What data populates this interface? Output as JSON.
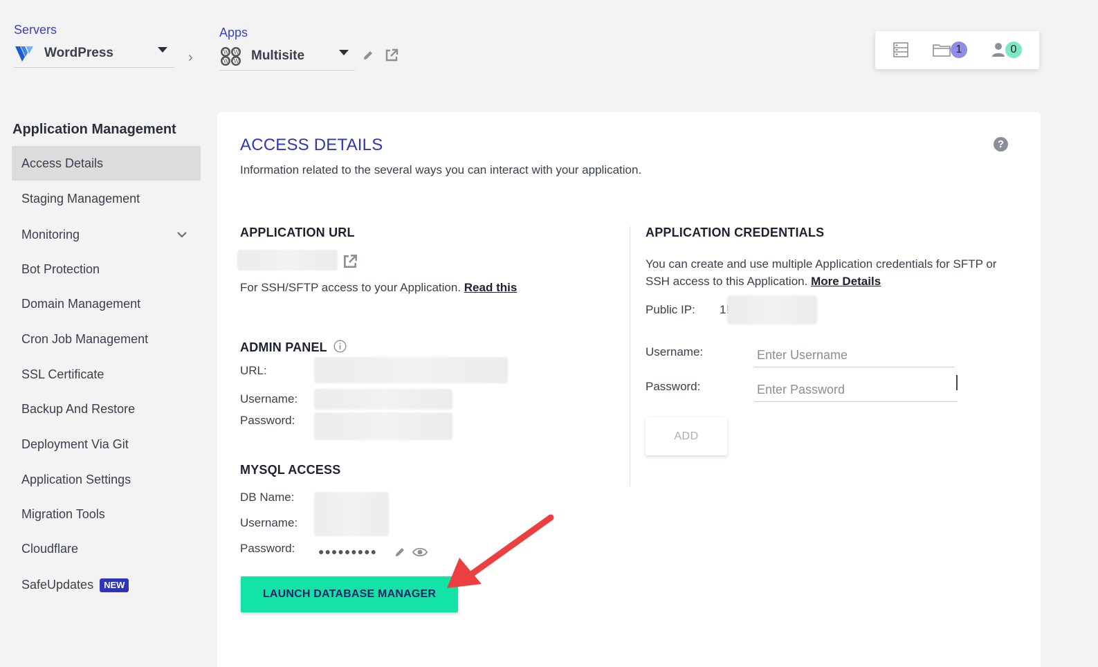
{
  "breadcrumb": {
    "servers_label": "Servers",
    "server_name": "WordPress",
    "apps_label": "Apps",
    "app_name": "Multisite"
  },
  "top_icons": {
    "folder_count": "1",
    "users_count": "0"
  },
  "sidebar": {
    "title": "Application Management",
    "items": [
      {
        "label": "Access Details"
      },
      {
        "label": "Staging Management"
      },
      {
        "label": "Monitoring"
      },
      {
        "label": "Bot Protection"
      },
      {
        "label": "Domain Management"
      },
      {
        "label": "Cron Job Management"
      },
      {
        "label": "SSL Certificate"
      },
      {
        "label": "Backup And Restore"
      },
      {
        "label": "Deployment Via Git"
      },
      {
        "label": "Application Settings"
      },
      {
        "label": "Migration Tools"
      },
      {
        "label": "Cloudflare"
      },
      {
        "label": "SafeUpdates"
      }
    ],
    "new_badge": "NEW"
  },
  "main": {
    "title": "ACCESS DETAILS",
    "subtitle": "Information related to the several ways you can interact with your application.",
    "help": "?",
    "app_url": {
      "heading": "APPLICATION URL",
      "ssh_text": "For SSH/SFTP access to your Application.",
      "read_this": "Read this"
    },
    "admin_panel": {
      "heading": "ADMIN PANEL",
      "url_label": "URL:",
      "username_label": "Username:",
      "password_label": "Password:"
    },
    "mysql": {
      "heading": "MYSQL ACCESS",
      "db_name_label": "DB Name:",
      "username_label": "Username:",
      "password_label": "Password:",
      "password_mask": "●●●●●●●●●",
      "launch_label": "LAUNCH DATABASE MANAGER"
    },
    "credentials": {
      "heading": "APPLICATION CREDENTIALS",
      "desc": "You can create and use multiple Application credentials for SFTP or SSH access to this Application.",
      "more_details": "More Details",
      "public_ip_label": "Public IP:",
      "public_ip_partial": "1!",
      "username_label": "Username:",
      "username_placeholder": "Enter Username",
      "password_label": "Password:",
      "password_placeholder": "Enter Password",
      "add_label": "ADD"
    }
  }
}
